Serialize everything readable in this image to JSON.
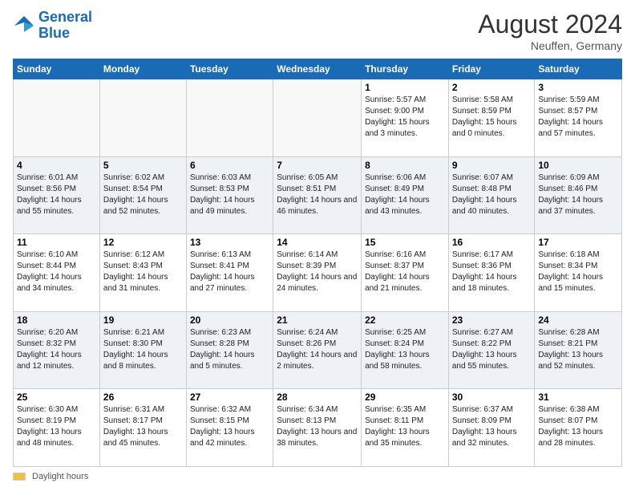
{
  "header": {
    "logo_line1": "General",
    "logo_line2": "Blue",
    "month_title": "August 2024",
    "location": "Neuffen, Germany"
  },
  "days_of_week": [
    "Sunday",
    "Monday",
    "Tuesday",
    "Wednesday",
    "Thursday",
    "Friday",
    "Saturday"
  ],
  "footer": {
    "swatch_label": "Daylight hours"
  },
  "weeks": [
    [
      {
        "day": "",
        "info": ""
      },
      {
        "day": "",
        "info": ""
      },
      {
        "day": "",
        "info": ""
      },
      {
        "day": "",
        "info": ""
      },
      {
        "day": "1",
        "info": "Sunrise: 5:57 AM\nSunset: 9:00 PM\nDaylight: 15 hours\nand 3 minutes."
      },
      {
        "day": "2",
        "info": "Sunrise: 5:58 AM\nSunset: 8:59 PM\nDaylight: 15 hours\nand 0 minutes."
      },
      {
        "day": "3",
        "info": "Sunrise: 5:59 AM\nSunset: 8:57 PM\nDaylight: 14 hours\nand 57 minutes."
      }
    ],
    [
      {
        "day": "4",
        "info": "Sunrise: 6:01 AM\nSunset: 8:56 PM\nDaylight: 14 hours\nand 55 minutes."
      },
      {
        "day": "5",
        "info": "Sunrise: 6:02 AM\nSunset: 8:54 PM\nDaylight: 14 hours\nand 52 minutes."
      },
      {
        "day": "6",
        "info": "Sunrise: 6:03 AM\nSunset: 8:53 PM\nDaylight: 14 hours\nand 49 minutes."
      },
      {
        "day": "7",
        "info": "Sunrise: 6:05 AM\nSunset: 8:51 PM\nDaylight: 14 hours\nand 46 minutes."
      },
      {
        "day": "8",
        "info": "Sunrise: 6:06 AM\nSunset: 8:49 PM\nDaylight: 14 hours\nand 43 minutes."
      },
      {
        "day": "9",
        "info": "Sunrise: 6:07 AM\nSunset: 8:48 PM\nDaylight: 14 hours\nand 40 minutes."
      },
      {
        "day": "10",
        "info": "Sunrise: 6:09 AM\nSunset: 8:46 PM\nDaylight: 14 hours\nand 37 minutes."
      }
    ],
    [
      {
        "day": "11",
        "info": "Sunrise: 6:10 AM\nSunset: 8:44 PM\nDaylight: 14 hours\nand 34 minutes."
      },
      {
        "day": "12",
        "info": "Sunrise: 6:12 AM\nSunset: 8:43 PM\nDaylight: 14 hours\nand 31 minutes."
      },
      {
        "day": "13",
        "info": "Sunrise: 6:13 AM\nSunset: 8:41 PM\nDaylight: 14 hours\nand 27 minutes."
      },
      {
        "day": "14",
        "info": "Sunrise: 6:14 AM\nSunset: 8:39 PM\nDaylight: 14 hours\nand 24 minutes."
      },
      {
        "day": "15",
        "info": "Sunrise: 6:16 AM\nSunset: 8:37 PM\nDaylight: 14 hours\nand 21 minutes."
      },
      {
        "day": "16",
        "info": "Sunrise: 6:17 AM\nSunset: 8:36 PM\nDaylight: 14 hours\nand 18 minutes."
      },
      {
        "day": "17",
        "info": "Sunrise: 6:18 AM\nSunset: 8:34 PM\nDaylight: 14 hours\nand 15 minutes."
      }
    ],
    [
      {
        "day": "18",
        "info": "Sunrise: 6:20 AM\nSunset: 8:32 PM\nDaylight: 14 hours\nand 12 minutes."
      },
      {
        "day": "19",
        "info": "Sunrise: 6:21 AM\nSunset: 8:30 PM\nDaylight: 14 hours\nand 8 minutes."
      },
      {
        "day": "20",
        "info": "Sunrise: 6:23 AM\nSunset: 8:28 PM\nDaylight: 14 hours\nand 5 minutes."
      },
      {
        "day": "21",
        "info": "Sunrise: 6:24 AM\nSunset: 8:26 PM\nDaylight: 14 hours\nand 2 minutes."
      },
      {
        "day": "22",
        "info": "Sunrise: 6:25 AM\nSunset: 8:24 PM\nDaylight: 13 hours\nand 58 minutes."
      },
      {
        "day": "23",
        "info": "Sunrise: 6:27 AM\nSunset: 8:22 PM\nDaylight: 13 hours\nand 55 minutes."
      },
      {
        "day": "24",
        "info": "Sunrise: 6:28 AM\nSunset: 8:21 PM\nDaylight: 13 hours\nand 52 minutes."
      }
    ],
    [
      {
        "day": "25",
        "info": "Sunrise: 6:30 AM\nSunset: 8:19 PM\nDaylight: 13 hours\nand 48 minutes."
      },
      {
        "day": "26",
        "info": "Sunrise: 6:31 AM\nSunset: 8:17 PM\nDaylight: 13 hours\nand 45 minutes."
      },
      {
        "day": "27",
        "info": "Sunrise: 6:32 AM\nSunset: 8:15 PM\nDaylight: 13 hours\nand 42 minutes."
      },
      {
        "day": "28",
        "info": "Sunrise: 6:34 AM\nSunset: 8:13 PM\nDaylight: 13 hours\nand 38 minutes."
      },
      {
        "day": "29",
        "info": "Sunrise: 6:35 AM\nSunset: 8:11 PM\nDaylight: 13 hours\nand 35 minutes."
      },
      {
        "day": "30",
        "info": "Sunrise: 6:37 AM\nSunset: 8:09 PM\nDaylight: 13 hours\nand 32 minutes."
      },
      {
        "day": "31",
        "info": "Sunrise: 6:38 AM\nSunset: 8:07 PM\nDaylight: 13 hours\nand 28 minutes."
      }
    ]
  ]
}
